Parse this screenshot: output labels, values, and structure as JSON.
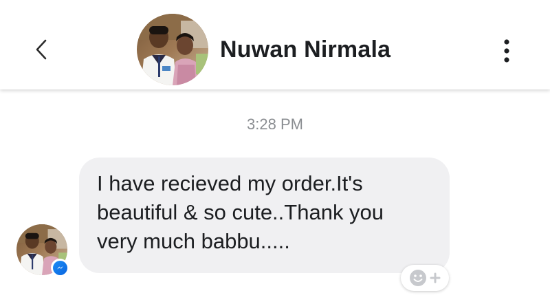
{
  "header": {
    "back_icon": "chevron-left-icon",
    "contact_name": "Nuwan Nirmala",
    "avatar": "profile-photo-two-children",
    "more_icon": "vertical-ellipsis-icon"
  },
  "conversation": {
    "timestamp": "3:28 PM",
    "messages": [
      {
        "direction": "incoming",
        "text": "I have recieved my order.It's\nbeautiful & so cute..Thank you\nvery much babbu.....",
        "sender_badge_icon": "messenger-icon",
        "reaction_button_icon": "add-reaction-icon"
      }
    ]
  },
  "colors": {
    "bubble_incoming": "#f0f0f2",
    "timestamp_text": "#8a8d91",
    "messenger_blue": "#0a7cff",
    "header_text": "#1c1e21"
  }
}
